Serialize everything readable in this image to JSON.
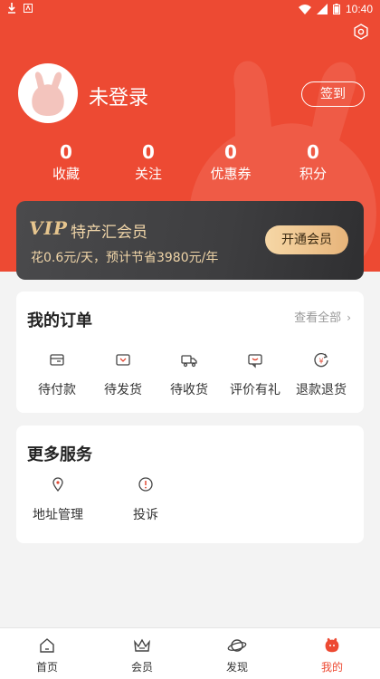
{
  "statusbar": {
    "time": "10:40"
  },
  "profile": {
    "username": "未登录",
    "checkin_label": "签到"
  },
  "stats": [
    {
      "value": "0",
      "label": "收藏"
    },
    {
      "value": "0",
      "label": "关注"
    },
    {
      "value": "0",
      "label": "优惠券"
    },
    {
      "value": "0",
      "label": "积分"
    }
  ],
  "vip": {
    "logo": "VIP",
    "title": "特产汇会员",
    "subtitle": "花0.6元/天，预计节省3980元/年",
    "button": "开通会员"
  },
  "orders": {
    "title": "我的订单",
    "view_all": "查看全部",
    "items": [
      {
        "label": "待付款",
        "icon": "wallet-icon"
      },
      {
        "label": "待发货",
        "icon": "box-icon"
      },
      {
        "label": "待收货",
        "icon": "truck-icon"
      },
      {
        "label": "评价有礼",
        "icon": "comment-icon"
      },
      {
        "label": "退款退货",
        "icon": "refund-icon"
      }
    ]
  },
  "services": {
    "title": "更多服务",
    "items": [
      {
        "label": "地址管理",
        "icon": "location-icon"
      },
      {
        "label": "投诉",
        "icon": "alert-icon"
      }
    ]
  },
  "tabbar": {
    "items": [
      {
        "label": "首页",
        "icon": "home-icon"
      },
      {
        "label": "会员",
        "icon": "crown-icon"
      },
      {
        "label": "发现",
        "icon": "planet-icon"
      },
      {
        "label": "我的",
        "icon": "profile-icon",
        "active": true
      }
    ]
  },
  "colors": {
    "brand": "#ed4a33",
    "vip_gold": "#f0d5a8"
  }
}
